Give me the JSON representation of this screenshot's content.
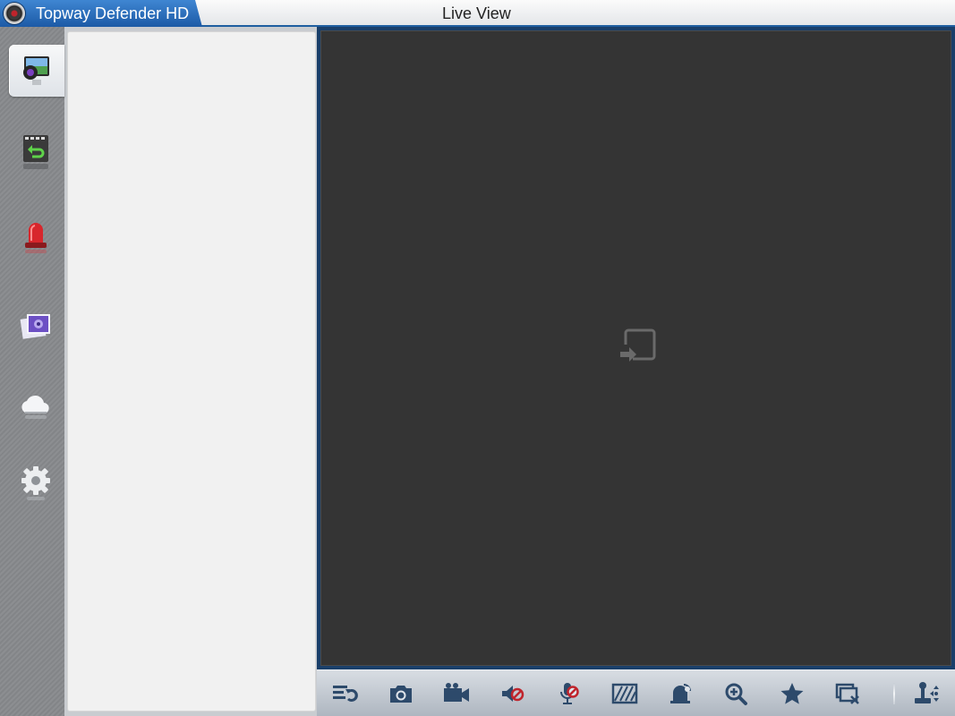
{
  "app": {
    "title": "Topway Defender HD",
    "view_title": "Live View"
  },
  "sidebar": {
    "items": [
      {
        "name": "live-view",
        "icon": "live-view-monitor-icon",
        "active": true
      },
      {
        "name": "playback",
        "icon": "playback-film-icon",
        "active": false
      },
      {
        "name": "alarm",
        "icon": "alarm-siren-icon",
        "active": false
      },
      {
        "name": "gallery",
        "icon": "photo-gallery-icon",
        "active": false
      },
      {
        "name": "cloud",
        "icon": "cloud-icon",
        "active": false
      },
      {
        "name": "settings",
        "icon": "gear-icon",
        "active": false
      }
    ]
  },
  "live_view": {
    "add_camera_icon": "add-camera-icon"
  },
  "toolbar": {
    "buttons": [
      "stream-quality-icon",
      "snapshot-icon",
      "record-icon",
      "audio-mute-icon",
      "intercom-mute-icon",
      "window-layout-icon",
      "alarm-output-icon",
      "zoom-in-icon",
      "favorite-star-icon",
      "close-all-icon",
      "ptz-control-icon"
    ]
  },
  "colors": {
    "accent": "#1f5ea0",
    "title_tab": "#2f73c0",
    "video_bg": "#343434",
    "toolbar_icon": "#2d4a6b",
    "mute_red": "#c0242c"
  }
}
